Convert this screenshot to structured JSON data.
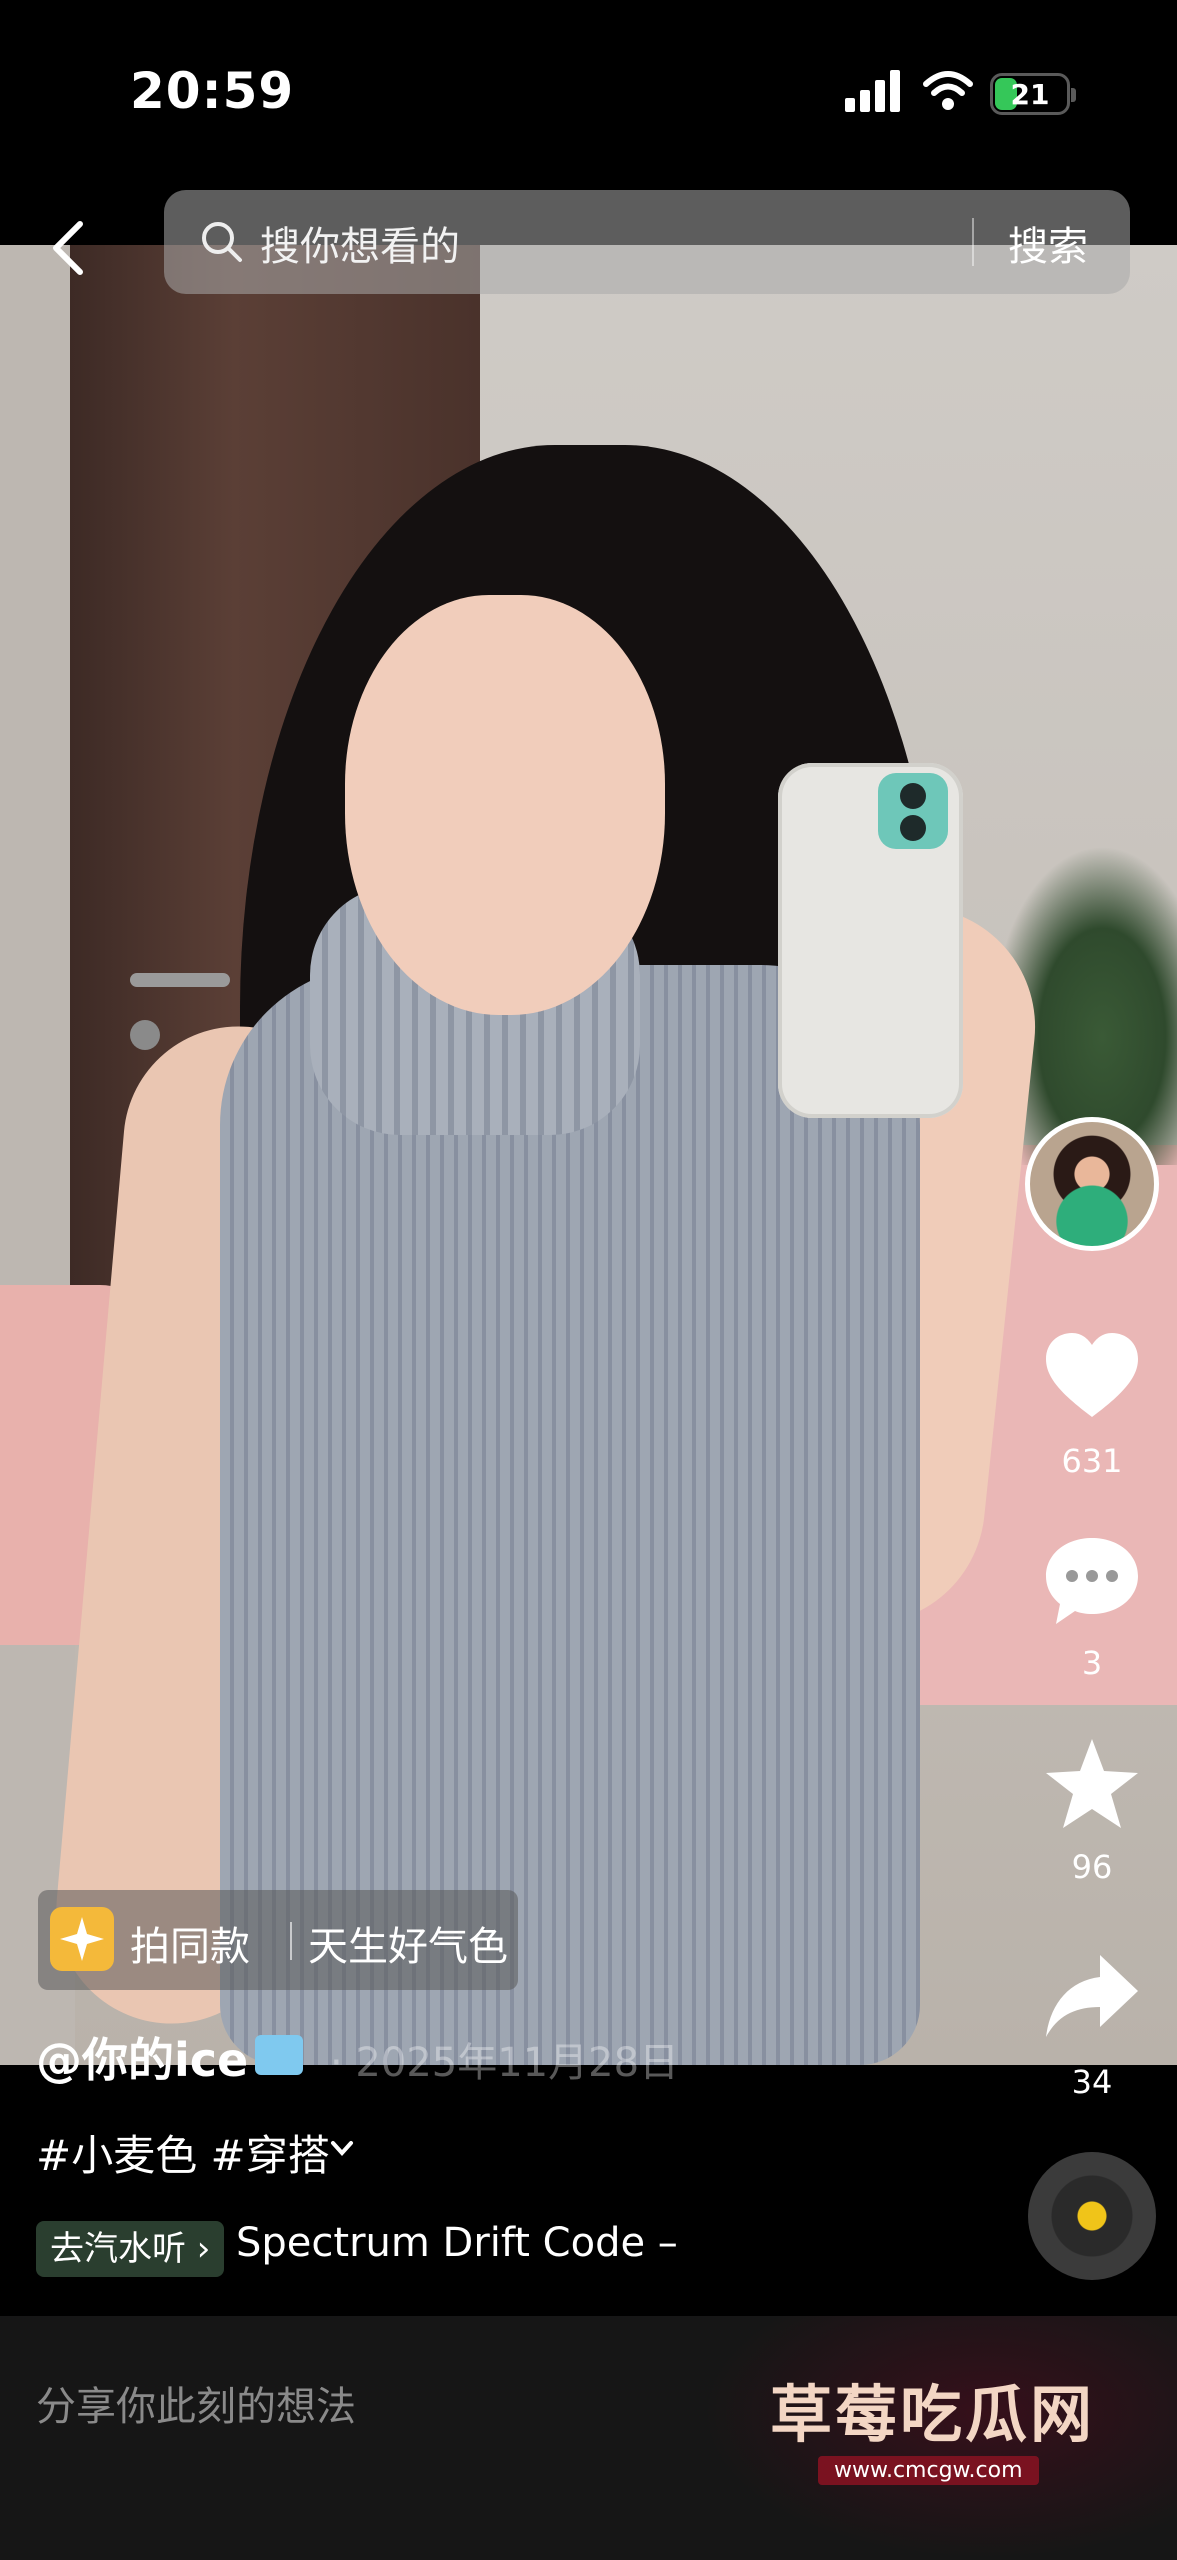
{
  "status_bar": {
    "time": "20:59",
    "battery": "21"
  },
  "search": {
    "placeholder": "搜你想看的",
    "button": "搜索"
  },
  "rail": {
    "likes": "631",
    "comments": "3",
    "favorites": "96",
    "shares": "34"
  },
  "overlay": {
    "same_style_label": "拍同款",
    "same_style_name": "天生好气色",
    "author": "@你的ice",
    "date": "· 2025年11月28日",
    "hashtags": "#小麦色 #穿搭",
    "music_tag": "去汽水听 ›",
    "music_title": "Spectrum Drift Code –"
  },
  "comment": {
    "placeholder": "分享你此刻的想法"
  },
  "watermark": {
    "title": "草莓吃瓜网",
    "url": "www.cmcgw.com"
  }
}
